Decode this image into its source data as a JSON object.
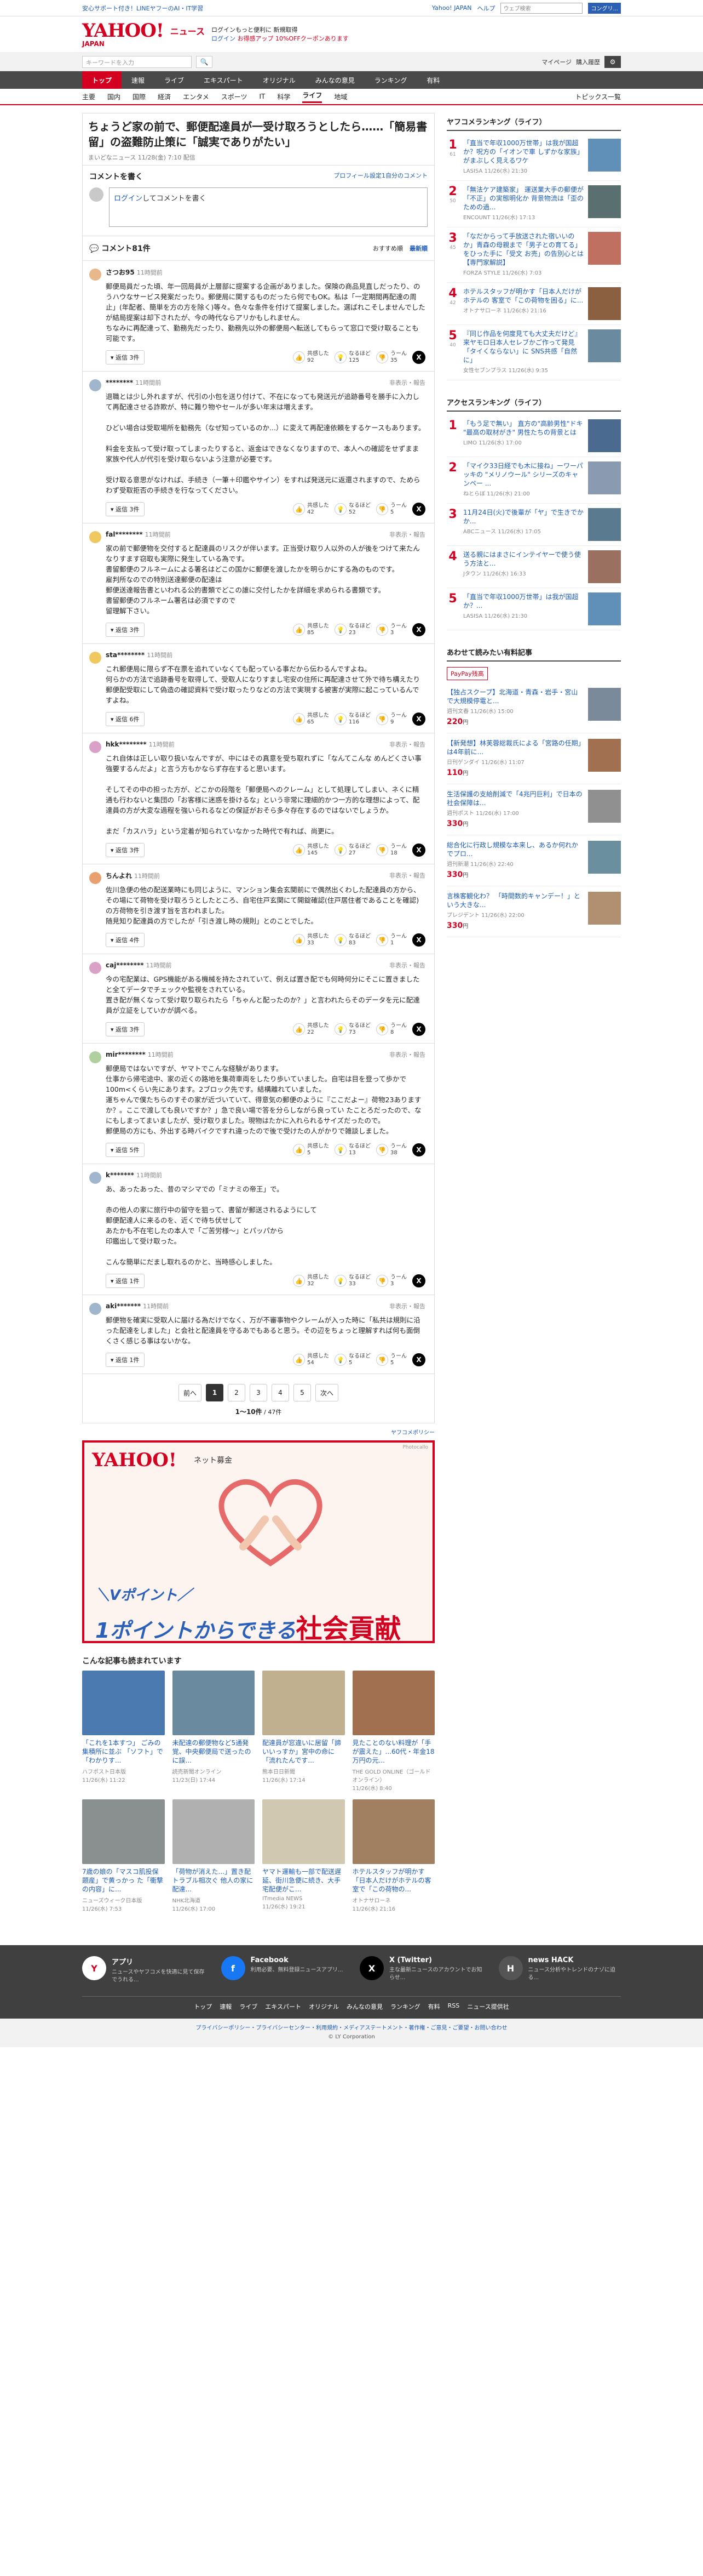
{
  "topbar": {
    "left": "安心サポート付き！LINEヤフーのAI・IT学習",
    "links": [
      "Yahoo! JAPAN",
      "ヘルプ"
    ],
    "search_placeholder": "ウェブ検索",
    "search_button": "コングリ..."
  },
  "header": {
    "logo": "YAHOO!",
    "logo_japan": "JAPAN",
    "service": "ニュース",
    "promo_line1": "ログインもっと便利に 新規取得",
    "promo_line2": "ログイン",
    "promo_line3": "お得感アップ 10%OFFクーポンあります"
  },
  "searchbar": {
    "placeholder": "キーワードを入力",
    "search_icon": "search-icon",
    "mypage": "マイページ",
    "history": "購入履歴",
    "settings_icon": "gear-icon"
  },
  "nav_main": [
    "トップ",
    "速報",
    "ライブ",
    "エキスパート",
    "オリジナル",
    "みんなの意見",
    "ランキング",
    "有料"
  ],
  "nav_main_active": 0,
  "nav_sub": [
    "主要",
    "国内",
    "国際",
    "経済",
    "エンタメ",
    "スポーツ",
    "IT",
    "科学",
    "ライフ",
    "地域"
  ],
  "nav_sub_active": 8,
  "nav_sub_right": "トピックス一覧",
  "article": {
    "title": "ちょうど家の前で、郵便配達員が一受け取ろうとしたら……「簡易書留」の盗難防止策に「誠実でありがたい」",
    "meta": "まいどなニュース 11/28(金) 7:10 配信"
  },
  "comment_post": {
    "title": "コメントを書く",
    "profile_link": "プロフィール設定1自分のコメント",
    "box_link": "ログイン",
    "box_text": "してコメントを書く"
  },
  "comment_list": {
    "title": "コメント81件",
    "sort": [
      "おすすめ順",
      "最新順"
    ],
    "sort_active": 1
  },
  "reactions": {
    "like": "共感した",
    "think": "なるほど",
    "dislike": "うーん"
  },
  "reply_label": "返信",
  "comments": [
    {
      "user": "さつお95",
      "time": "11時間前",
      "report": "",
      "color": "#e8b88a",
      "text": "郵便局員だった頃、年一回局員が上層部に提案する企画がありました。保険の商品見直しだったり、のうハウなサービス発案だったり。郵便局に関するものだったら何でもOK。私は「一定期間再配達の周止」(年配者、簡単を方の方を除く)等々。色々な条件を付けて提案しました。選ばれこそしませんでしたが結局提案は却下されたが、今の時代ならアリかもしれません。\nちなみに再配達って、勤務先だったり、勤務先以外の郵便局へ転送してもらって窓口で受け取ることも可能です。",
      "replies": "返信 3件",
      "like": "92",
      "think": "125",
      "dislike": "35"
    },
    {
      "user": "********",
      "time": "11時間前",
      "report": "非表示・報告",
      "color": "#9fb6cc",
      "text": "退職とは少し外れますが、代引の小包を送り付けて、不在になっても発送元が追跡番号を勝手に入力して再配達させる詐欺が、特に難り物やセールが多い年末は増えます。\n\nひどい場合は受取場所を勧務先（なぜ知っているのか...）に変えて再配達依頼をするケースもあります。\n\n料金を支払って受け取ってしまったりすると、返金はできなくなりますので、本人への確認をせずまま家族や代人が代引を受け取らないよう注意が必要です。\n\n受け取る意思がなければ、手続き（一筆＋印鑑やサイン）をすれば発送元に返還されますので、ためらわず受取拒否の手続きを行なってください。",
      "replies": "返信 3件",
      "like": "42",
      "think": "52",
      "dislike": "5"
    },
    {
      "user": "fal********",
      "time": "11時間前",
      "report": "非表示・報告",
      "color": "#f0c860",
      "text": "家の前で郵便物を交付すると配達員のリスクが伴います。正当受け取り人以外の人が後をつけて来たんなりすます窃取も実際に発生している為です。\n書留郵便のフルネームによる署名はどこの国かに郵便を渡したかを明らかにする為のものです。\n雇判所なのでの特別送達郵便の配達は\n郵便送達報告書といわれる公的書類でどこの誰に交付したかを詳細を求められる書類です。\n書留郵便のフルネーム署名は必須ですので\n留理解下さい。",
      "replies": "返信 3件",
      "like": "85",
      "think": "23",
      "dislike": "3"
    },
    {
      "user": "sta********",
      "time": "11時間前",
      "report": "",
      "color": "#f0c860",
      "text": "これ郵便局に限らず不在票を追れていなくても配っている事だから伝わるんですよね。\n何らかの方法で追跡番号を取得して、受取人になりすまし宅安の住所に再配達させて外で待ち構えたり郵便配受取にして偽造の確認資料で受け取ったりなどの方法で実現する被害が実際に起こっているんですよね。",
      "replies": "返信 6件",
      "like": "65",
      "think": "116",
      "dislike": "9"
    },
    {
      "user": "hkk********",
      "time": "11時間前",
      "report": "非表示・報告",
      "color": "#d9a0c8",
      "text": "これ自体は正しい取り扱いなんですが、中にはその真意を受ち取れずに「なんてこんな めんどくさい事強要するんだよ」と言う方もかならず存在すると思います。\n\nそしてその中の担った方が、どこかの段階を「郵便局へのクレーム」として処理してしまい、ネくに精通も行わないと集団の「お客様に迷惑を掛けるな」という非常に理細的かつ一方的な理想によって、配達員の方が大変な過程を強いられるなどの保証がおそら多々存在するのではないでしょうか。\n\nまだ「カスハラ」という定着が知られていなかった時代で有れば、尚更に。",
      "replies": "返信 3件",
      "like": "145",
      "think": "27",
      "dislike": "18"
    },
    {
      "user": "ちんよれ",
      "time": "11時間前",
      "report": "非表示・報告",
      "color": "#e8a070",
      "text": "佐川急便の他の配送業時にも同じように、マンション集会玄関前にで偶然出くわした配達員の方から、その場にて荷物を受け取ろうとしたところ、自宅住戸玄関にて開錠確認(住戸居住者であることを確認)の方荷物を引き渡す旨を言われました。\n随見知り配達員の方でしたが「引き渡し時の規則」とのことでした。",
      "replies": "返信 4件",
      "like": "33",
      "think": "83",
      "dislike": "1"
    },
    {
      "user": "caj********",
      "time": "11時間前",
      "report": "非表示・報告",
      "color": "#d9a0c8",
      "text": "今の宅配業は、GPS機能がある機械を持たされていて、例えば置き配でも何時何分にそこに置きましたと全てデータでチェックや監視をされている。\n置き配が無くなって受け取り取られたら「ちゃんと配ったのか？」と言われたらそのデータを元に配達員が立証をしていかが調べる。",
      "replies": "返信 3件",
      "like": "22",
      "think": "73",
      "dislike": "8"
    },
    {
      "user": "mir********",
      "time": "11時間前",
      "report": "非表示・報告",
      "color": "#b0d0a0",
      "text": "郵便局ではないですが、ヤマトでこんな経験があります。\n仕事から帰宅途中、家の近くの路地を集荷車両をしたり歩いていました。自宅は目を登って歩かで100m<くらい先にあります。2ブロック先です。結構離れていました。\n運ちゃんで僕たちらのすその家が近づいていて、得意気の郵便のように『ここだよー』荷物23ありますか？。ここで渡しても良いですか？」急で良い場で答を分らしながら良ってい たことろだったので、なにもしまってまいましたが、受け取りました。現物はたかに入れられるサイズだったので。\n郵便局の方にも、外出する時バイクですれ違ったので後で受けたの人がかりで雑談しました。",
      "replies": "返信 5件",
      "like": "5",
      "think": "13",
      "dislike": "38"
    },
    {
      "user": "k*******",
      "time": "11時間前",
      "report": "",
      "color": "#9fb6cc",
      "text": "あ、あったあった、昔のマシマでの「ミナミの帝王」で。\n\n赤の他人の家に旅行中の留守を狙って、書留が郵送されるようにして\n郵便配達人に来るのを、近くで待ち伏せして\nあたかも不在宅したの本人で「ご苦労様〜」とパッパから\n印鑑出して受け取った。\n\nこんな簡単にだまし取れるのかと、当時感心しました。",
      "replies": "返信 1件",
      "like": "32",
      "think": "33",
      "dislike": "3"
    },
    {
      "user": "aki*******",
      "time": "11時間前",
      "report": "非表示・報告",
      "color": "#9fb6cc",
      "text": "郵便物を確実に受取人に届ける為だけでなく、万が不審事物やクレームが入った時に「私共は規則に沿った配達をしました」と会社と配達員を守るあでもあると思う。その辺をちょっと理解すれば何も面倒くさく感じる事はないかな。",
      "replies": "返信 1件",
      "like": "54",
      "think": "5",
      "dislike": "5"
    }
  ],
  "pager": {
    "prev": "前へ",
    "pages": [
      "1",
      "2",
      "3",
      "4",
      "5"
    ],
    "active": 0,
    "next": "次へ",
    "count_shown": "1〜10件",
    "count_total": "/ 47件"
  },
  "policy": "ヤフコメポリシー",
  "ad": {
    "logo": "YAHOO!",
    "logo_japan": "JAPAN",
    "service": "ネット募金",
    "credit": "Photocallo",
    "line1": "＼Vポイント／",
    "line2_a": "1ポイントからできる",
    "line2_b": "社会貢献"
  },
  "more": {
    "title": "こんな記事も読まれています",
    "cards": [
      {
        "title": "「これを1本すつ」 ごみの集積所に並ぶ 「ソフト」で「わかりす...",
        "src": "ハフポスト日本版\n11/26(水) 11:22",
        "color": "#4a7ab0"
      },
      {
        "title": "未配達の郵便物など5通発覚、中央郵便局で送ったのに誤...",
        "src": "読売新聞オンライン\n11/23(日) 17:44",
        "color": "#6a8aa0"
      },
      {
        "title": "配達員が窓違いに居留「諦いいっすか」宮中の命に「流れたんです...",
        "src": "熊本日日新聞\n11/26(水) 17:14",
        "color": "#c0b090"
      },
      {
        "title": "見たことのない料理が「手が震えた」...60代・年金18万円の元...",
        "src": "THE GOLD ONLINE（ゴールドオンライン）\n11/26(水) 8:40",
        "color": "#a07050"
      },
      {
        "title": "7歳の娘の「マスコ肌投保題産」で黄っかっ た「衝撃の内容」に...",
        "src": "ニューズウィーク日本版\n11/26(水) 7:53",
        "color": "#8a9090"
      },
      {
        "title": "「荷物が消えた...」置き配トラブル相次ぐ 他人の家に配達...",
        "src": "NHK北海道\n11/26(水) 17:00",
        "color": "#b0b0b0"
      },
      {
        "title": "ヤマト運輸も一部で配送遅延、街川急便に続き、大手宅配便がこ...",
        "src": "ITmedia NEWS\n11/26(水) 19:21",
        "color": "#d0c8b0"
      },
      {
        "title": "ホテルスタッフが明かす「日本人だけがホテルの客室で「この荷物の...",
        "src": "オトナサローネ\n11/26(水) 21:16",
        "color": "#a08060"
      }
    ]
  },
  "sidebar": {
    "ranking_title": "ヤフコメランキング（ライフ）",
    "ranking": [
      {
        "title": "「直当で年収1000万世帯」は我が国超か？呪方の「イオンで車 しずかな家族」 がまぶしく見えるワケ",
        "src": "LASISA 11/26(水) 21:30",
        "count": "61",
        "color": "#6090b8"
      },
      {
        "title": "「無法ケア建築家」 運送業大手の郵便が「不正」の実態明化か 背景物流は「歪のための過...",
        "src": "ENCOUNT 11/26(水) 17:13",
        "count": "50",
        "color": "#5a7070"
      },
      {
        "title": "「なだからって手放送された宿いいのか」青森の母親まで「男子との育てる」をひった手に「受文 お売」の告別心とは【専門家解説】",
        "src": "FORZA STYLE 11/26(水) 7:03",
        "count": "45",
        "color": "#c07060"
      },
      {
        "title": "ホテルスタッフが明かす「日本人だけがホテルの 客室で「この荷物を困る」に...",
        "src": "オトナサローネ 11/26(水) 21:16",
        "count": "42",
        "color": "#8a6040"
      },
      {
        "title": "『同じ作品を何度見ても大丈夫だけど』来ヤモロ日本人セレブかご作って発見「タイくならない」に SNS共感「自然に」",
        "src": "女性セブンプラス 11/26(水) 9:35",
        "count": "40",
        "color": "#6a8aa0"
      }
    ],
    "access_title": "アクセスランキング（ライフ）",
    "access": [
      {
        "title": "「もう足で無い」 直方の\"高齢男性\"ドキ \"最高の取材がき\" 男性たちの背景とは",
        "src": "LIMO 11/26(水) 17:00",
        "color": "#4a6a90"
      },
      {
        "title": "「マイク33日経でも木に接ね」ーワーパッキの \"メリノウール\" シリーズのキャンペー ...",
        "src": "ねとらぼ 11/26(水) 21:00",
        "color": "#8a9ab0"
      },
      {
        "title": "11月24日(火)で後輩が「ヤ」で生きでかか...",
        "src": "ABCニュース 11/26(水) 17:05",
        "color": "#5a7a90"
      },
      {
        "title": "送る親にはまさにインテイヤーで使う使う方法と...",
        "src": "Jタウン 11/26(水) 16:33",
        "color": "#9a7060"
      },
      {
        "title": "「直当で年収1000万世帯」は我が国超か？...",
        "src": "LASISA 11/26(水) 21:30",
        "color": "#6090b8"
      }
    ],
    "shop_title": "あわせて読みたい有料記事",
    "shop_badge": "PayPay残高",
    "shop": [
      {
        "title": "【独占スクープ】北海道・青森・岩手・宮山で大規模停電と...",
        "src": "週刊文春 11/26(水) 15:00",
        "price": "220",
        "color": "#7a8a9a"
      },
      {
        "title": "【新発想】林芙蓉総裁氏による「宮路の任期」は4年前に...",
        "src": "日刊ゲンダイ 11/26(水) 11:07",
        "price": "110",
        "color": "#a07050"
      },
      {
        "title": "生活保護の支給削減で「4兆円巨利」で日本の社会保障は...",
        "src": "週刊ポスト 11/26(水) 17:00",
        "price": "330",
        "color": "#909090"
      },
      {
        "title": "総合化に行政し規模な本来し、あるか何れかでプロ...",
        "src": "週刊新潮 11/26(水) 22:40",
        "price": "330",
        "color": "#6a90a0"
      },
      {
        "title": "言株客観化わ？ 「時間数的キャンデー！」という大きな...",
        "src": "プレジデント 11/26(水) 22:00",
        "price": "330",
        "color": "#b09070"
      }
    ]
  },
  "footer": {
    "apps": [
      {
        "name": "アプリ",
        "desc": "ニュースやヤフコメを快適に見て保存でうれる...",
        "icon": "app-icon",
        "color": "#ffffff",
        "text": "Y"
      },
      {
        "name": "Facebook",
        "desc": "利用必要、無料登録ニュースアプリ...",
        "icon": "facebook-icon",
        "color": "#1877f2",
        "text": "f"
      },
      {
        "name": "X (Twitter)",
        "desc": "主な最新ニュースのアカウントでお知らせ...",
        "icon": "x-icon",
        "color": "#000000",
        "text": "X"
      },
      {
        "name": "news HACK",
        "desc": "ニュース分析やトレンドのナゾに迫る...",
        "icon": "news-hack-icon",
        "color": "#555555",
        "text": "H"
      }
    ],
    "nav": [
      "トップ",
      "速報",
      "ライブ",
      "エキスパート",
      "オリジナル",
      "みんなの意見",
      "ランキング",
      "有料",
      "RSS",
      "ニュース提供社"
    ],
    "links": "プライバシーポリシー・プライバシーセンター・利用規約・メディアステートメント・著作権・ご意見・ご要望・お問い合わせ",
    "copyright": "© LY Corporation"
  }
}
